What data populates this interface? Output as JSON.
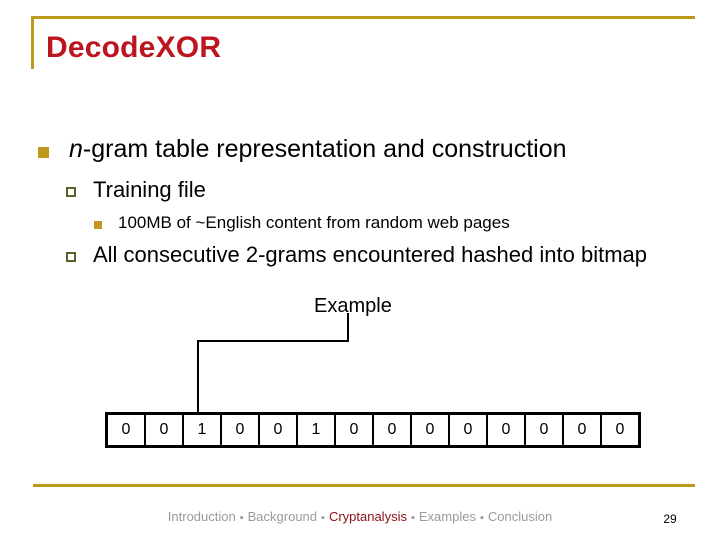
{
  "slide": {
    "title": "DecodeXOR",
    "page_number": "29",
    "accent_gold": "#bd9a1c",
    "title_red": "#bc1520",
    "footer_active_red": "#8a1018",
    "footer_gray": "#9a9a9a",
    "level2_bullet_green": "#53642c"
  },
  "body": {
    "bullet_l1": {
      "text_italic": "n",
      "text_rest": "-gram table representation and construction",
      "marker": "filled-square"
    },
    "bullet_l2_a": {
      "text": "Training file",
      "marker": "hollow-square"
    },
    "bullet_l3_a": {
      "text": "100MB of ~English content from random web pages",
      "marker": "filled-square-small"
    },
    "bullet_l2_b": {
      "text": "All consecutive 2-grams encountered hashed into bitmap",
      "marker": "hollow-square"
    },
    "example_label": "Example"
  },
  "bitmap": {
    "cells": [
      "0",
      "0",
      "1",
      "0",
      "0",
      "1",
      "0",
      "0",
      "0",
      "0",
      "0",
      "0",
      "0",
      "0"
    ]
  },
  "footer": {
    "items": [
      {
        "label": "Introduction",
        "active": false
      },
      {
        "label": "Background",
        "active": false
      },
      {
        "label": "Cryptanalysis",
        "active": true
      },
      {
        "label": "Examples",
        "active": false
      },
      {
        "label": "Conclusion",
        "active": false
      }
    ],
    "separator": "▪"
  }
}
